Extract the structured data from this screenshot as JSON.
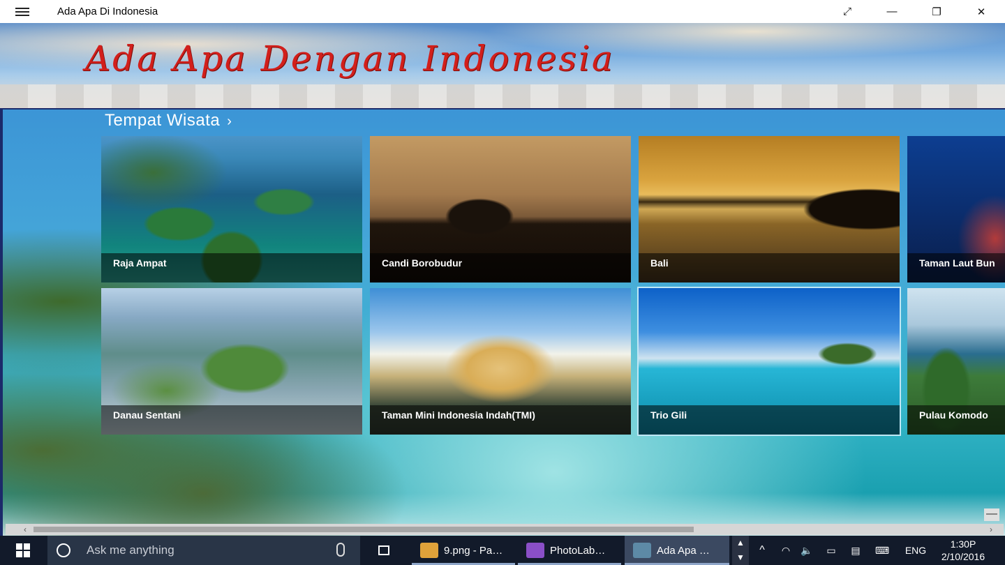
{
  "window": {
    "title": "Ada Apa Di Indonesia",
    "controls": {
      "fullscreen": "⤢",
      "minimize": "—",
      "restore": "❐",
      "close": "✕"
    }
  },
  "banner": {
    "title": "Ada Apa Dengan Indonesia"
  },
  "section": {
    "title": "Tempat Wisata",
    "chevron": "›"
  },
  "tiles": [
    {
      "label": "Raja Ampat",
      "scene": "islands"
    },
    {
      "label": "Candi Borobudur",
      "scene": "temple-silhouette"
    },
    {
      "label": "Bali",
      "scene": "sunset-temple"
    },
    {
      "label": "Taman Laut Bun",
      "scene": "coral-reef"
    },
    {
      "label": "Danau Sentani",
      "scene": "lake-hills"
    },
    {
      "label": "Taman Mini Indonesia Indah(TMI)",
      "scene": "theater-dome"
    },
    {
      "label": "Trio Gili",
      "scene": "tropical-sea"
    },
    {
      "label": "Pulau Komodo",
      "scene": "island-hills"
    }
  ],
  "scrollbar": {
    "left_arrow": "‹",
    "right_arrow": "›",
    "minimize_glyph": "—"
  },
  "taskbar": {
    "search_placeholder": "Ask me anything",
    "tasks": [
      {
        "label": "9.png - Pa…",
        "icon": "paint-icon",
        "color": "#e0a23a"
      },
      {
        "label": "PhotoLab…",
        "icon": "visual-studio-icon",
        "color": "#8a4fc7"
      },
      {
        "label": "Ada Apa …",
        "icon": "app-icon",
        "color": "#5d8aa6"
      }
    ],
    "tray": {
      "up_arrow": "^",
      "language": "ENG",
      "time": "1:30P",
      "date": "2/10/2016"
    }
  },
  "colors": {
    "banner_title": "#d21f1b",
    "main_blue": "#3c95d6",
    "taskbar": "#121a2a",
    "active_task": "#3b4961"
  }
}
